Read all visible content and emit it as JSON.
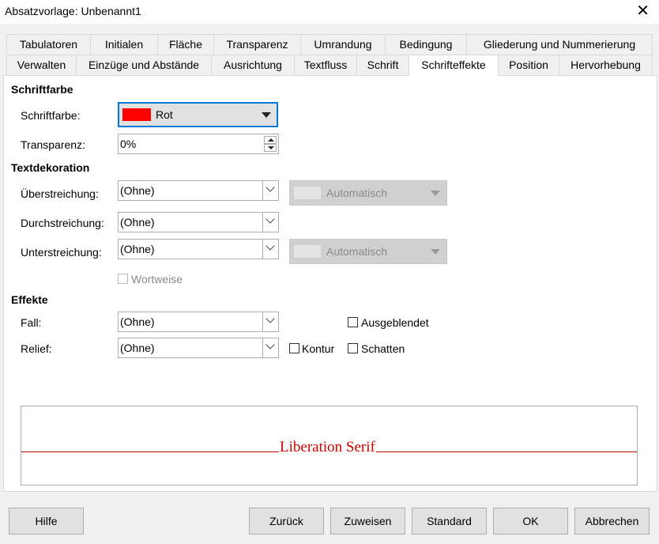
{
  "window": {
    "title": "Absatzvorlage: Unbenannt1",
    "close_glyph": "✕"
  },
  "tabs_row1": [
    "Tabulatoren",
    "Initialen",
    "Fläche",
    "Transparenz",
    "Umrandung",
    "Bedingung",
    "Gliederung und Nummerierung"
  ],
  "tabs_row2": [
    "Verwalten",
    "Einzüge und Abstände",
    "Ausrichtung",
    "Textfluss",
    "Schrift",
    "Schrifteffekte",
    "Position",
    "Hervorhebung"
  ],
  "active_tab": "Schrifteffekte",
  "schriftfarbe": {
    "section": "Schriftfarbe",
    "label": "Schriftfarbe:",
    "value": "Rot",
    "color": "#ff0000",
    "transparency_label": "Transparenz:",
    "transparency_value": "0%"
  },
  "textdekoration": {
    "section": "Textdekoration",
    "ueberstreichung_label": "Überstreichung:",
    "ueberstreichung_value": "(Ohne)",
    "ueberstreichung_color": "Automatisch",
    "durchstreichung_label": "Durchstreichung:",
    "durchstreichung_value": "(Ohne)",
    "unterstreichung_label": "Unterstreichung:",
    "unterstreichung_value": "(Ohne)",
    "unterstreichung_color": "Automatisch",
    "wortweise_label": "Wortweise"
  },
  "effekte": {
    "section": "Effekte",
    "fall_label": "Fall:",
    "fall_value": "(Ohne)",
    "relief_label": "Relief:",
    "relief_value": "(Ohne)",
    "ausgeblendet_label": "Ausgeblendet",
    "kontur_label": "Kontur",
    "schatten_label": "Schatten"
  },
  "preview": {
    "text": "Liberation Serif",
    "color": "#d00000"
  },
  "buttons": {
    "help": "Hilfe",
    "back": "Zurück",
    "apply": "Zuweisen",
    "standard": "Standard",
    "ok": "OK",
    "cancel": "Abbrechen"
  }
}
